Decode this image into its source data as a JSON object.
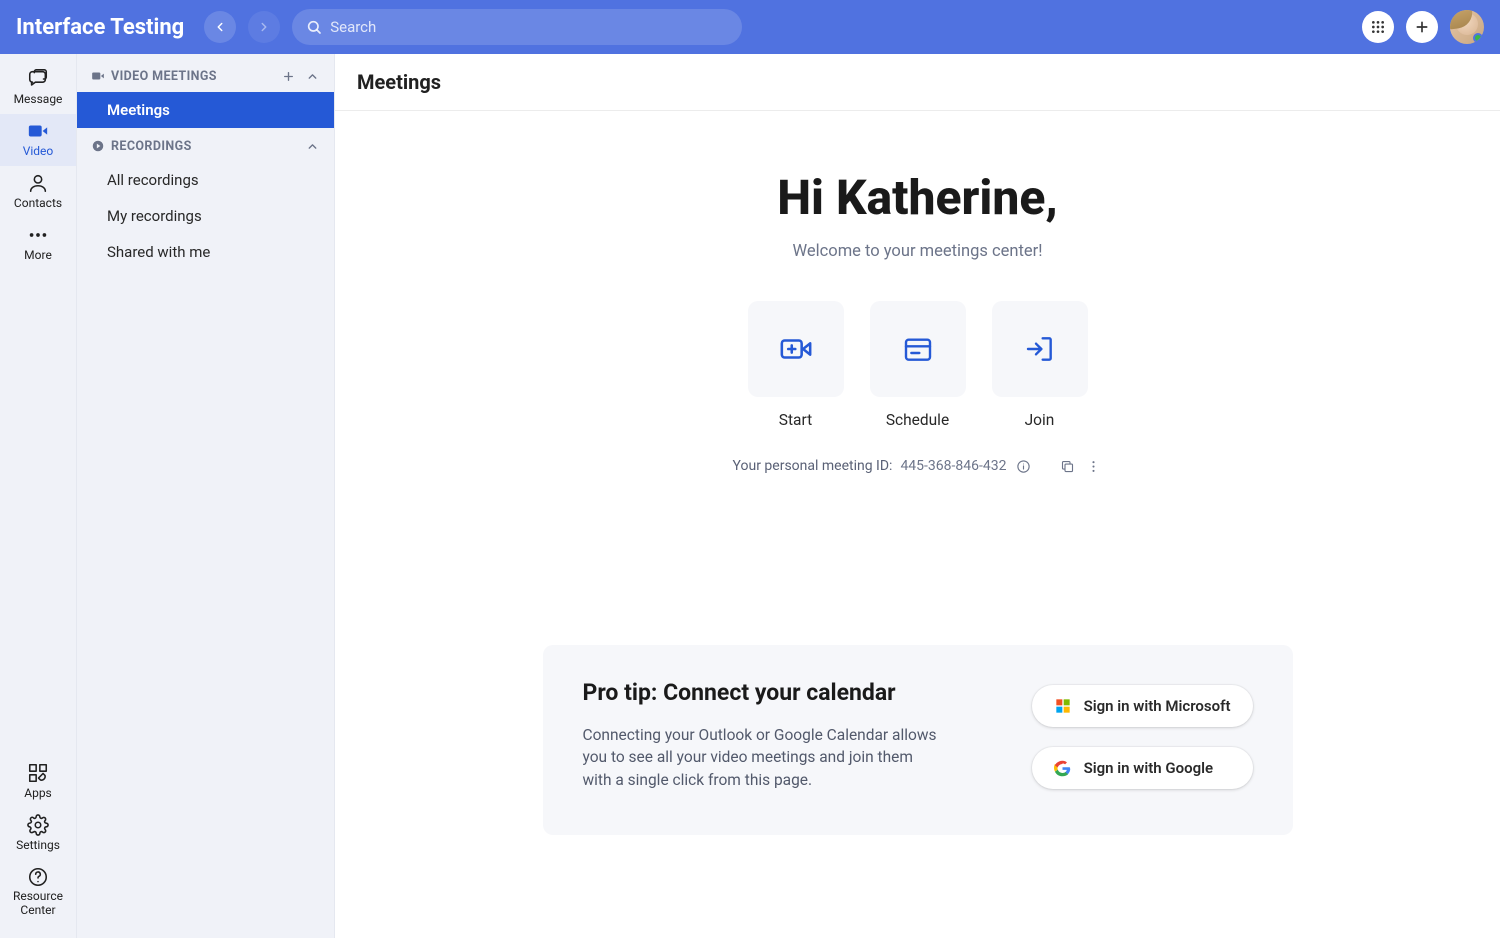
{
  "app": {
    "title": "Interface Testing"
  },
  "search": {
    "placeholder": "Search"
  },
  "rail": {
    "items": [
      {
        "id": "message",
        "label": "Message"
      },
      {
        "id": "video",
        "label": "Video"
      },
      {
        "id": "contacts",
        "label": "Contacts"
      },
      {
        "id": "more",
        "label": "More"
      }
    ],
    "bottom": [
      {
        "id": "apps",
        "label": "Apps"
      },
      {
        "id": "settings",
        "label": "Settings"
      },
      {
        "id": "resource",
        "label": "Resource Center"
      }
    ]
  },
  "panel": {
    "sections": [
      {
        "id": "video-meetings",
        "title": "VIDEO MEETINGS",
        "has_add": true,
        "items": [
          {
            "id": "meetings",
            "label": "Meetings",
            "selected": true
          }
        ]
      },
      {
        "id": "recordings",
        "title": "RECORDINGS",
        "has_add": false,
        "items": [
          {
            "id": "all",
            "label": "All recordings"
          },
          {
            "id": "my",
            "label": "My recordings"
          },
          {
            "id": "shared",
            "label": "Shared with me"
          }
        ]
      }
    ]
  },
  "main": {
    "header": "Meetings",
    "greeting": "Hi Katherine,",
    "subtitle": "Welcome to your meetings center!",
    "tiles": [
      {
        "id": "start",
        "label": "Start"
      },
      {
        "id": "schedule",
        "label": "Schedule"
      },
      {
        "id": "join",
        "label": "Join"
      }
    ],
    "pmi": {
      "label": "Your personal meeting ID:",
      "value": "445-368-846-432"
    },
    "protip": {
      "title": "Pro tip: Connect your calendar",
      "body": "Connecting your Outlook or Google Calendar allows you to see all your video meetings and join them with a single click from this page.",
      "microsoft": "Sign in with Microsoft",
      "google": "Sign in with Google"
    }
  }
}
